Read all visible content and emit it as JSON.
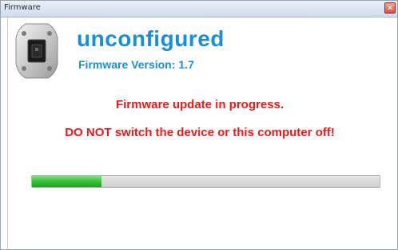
{
  "window": {
    "title": "Firmware",
    "close_glyph": "✕"
  },
  "device": {
    "icon": "device-icon",
    "name": "unconfigured",
    "firmware_label": "Firmware Version:",
    "firmware_version": "1.7"
  },
  "status": {
    "line1": "Firmware update in progress.",
    "line2": "DO NOT switch the device or this computer off!"
  },
  "progress": {
    "value": 0.2
  },
  "colors": {
    "accent_blue": "#1a8fd4",
    "warning_red": "#f01818",
    "progress_green": "#2fbf2f",
    "progress_track": "#d6d6d6"
  }
}
